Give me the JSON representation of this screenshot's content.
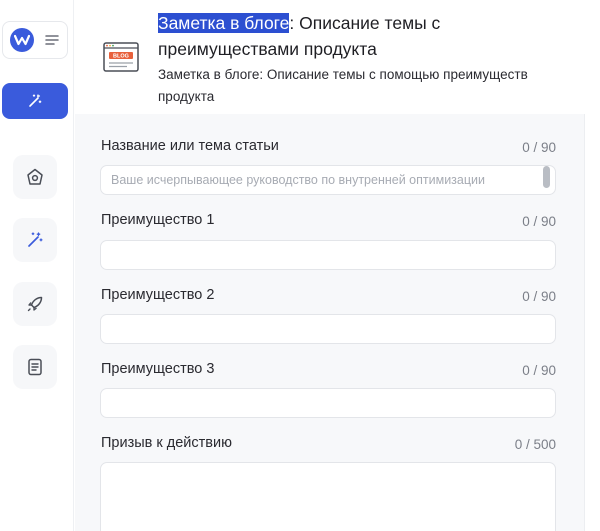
{
  "header": {
    "title_highlight": "Заметка в блоге",
    "title_rest": ": Описание темы с преимуществами продукта",
    "subtitle": "Заметка в блоге: Описание темы с помощью преимуществ продукта",
    "icon": "blog-document-icon",
    "icon_label": "BLOG"
  },
  "sidebar": {
    "logo": "w-logo-icon",
    "menu_icon": "menu-icon",
    "primary_button_icon": "magic-wand-icon",
    "items": [
      {
        "icon": "home-icon"
      },
      {
        "icon": "magic-wand-icon"
      },
      {
        "icon": "rocket-icon"
      },
      {
        "icon": "document-icon"
      }
    ]
  },
  "form": {
    "fields": [
      {
        "label": "Название или тема статьи",
        "counter": "0 / 90",
        "placeholder": "Ваше исчерпывающее руководство по внутренней оптимизации",
        "value": ""
      },
      {
        "label": "Преимущество 1",
        "counter": "0 / 90",
        "placeholder": "",
        "value": ""
      },
      {
        "label": "Преимущество 2",
        "counter": "0 / 90",
        "placeholder": "",
        "value": ""
      },
      {
        "label": "Преимущество 3",
        "counter": "0 / 90",
        "placeholder": "",
        "value": ""
      },
      {
        "label": "Призыв к действию",
        "counter": "0 / 500",
        "placeholder": "",
        "value": ""
      }
    ]
  },
  "colors": {
    "accent": "#3a5bdc",
    "highlight": "#2c4fd1",
    "form_background": "#f7f8fa"
  }
}
